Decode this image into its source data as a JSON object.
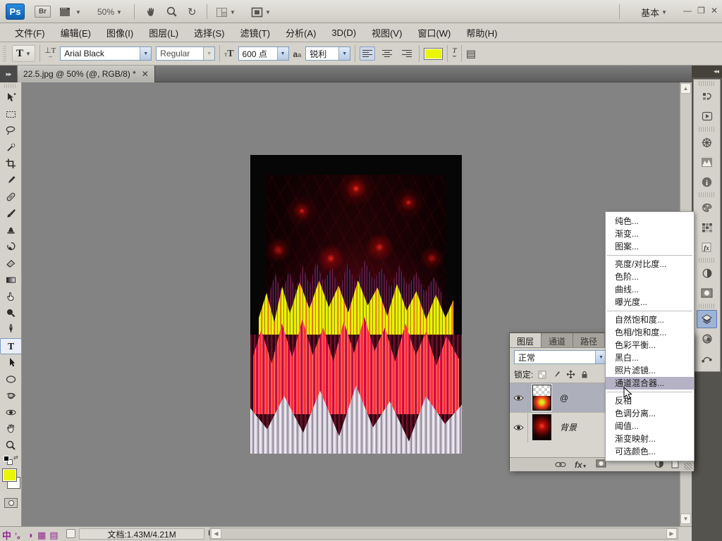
{
  "window": {
    "workspace": "基本"
  },
  "app_bar": {
    "ps_logo": "Ps",
    "bridge": "Br",
    "zoom_level": "50%"
  },
  "menu_bar": {
    "items": [
      "文件(F)",
      "编辑(E)",
      "图像(I)",
      "图层(L)",
      "选择(S)",
      "滤镜(T)",
      "分析(A)",
      "3D(D)",
      "视图(V)",
      "窗口(W)",
      "帮助(H)"
    ]
  },
  "options_bar": {
    "font_family": "Arial Black",
    "font_style": "Regular",
    "font_size": "600 点",
    "anti_alias": "锐利"
  },
  "document": {
    "tab_title": "22.5.jpg @ 50% (@, RGB/8) *"
  },
  "layers_panel": {
    "tabs": [
      "图层",
      "通道",
      "路径"
    ],
    "blend_mode": "正常",
    "lock_label": "锁定:",
    "fx_label": "fx",
    "layers": [
      {
        "name": "@"
      },
      {
        "name": "背景"
      }
    ]
  },
  "adjustments_menu": {
    "highlighted_item": "通道混合器...",
    "items": [
      {
        "label": "纯色..."
      },
      {
        "label": "渐变..."
      },
      {
        "label": "图案..."
      },
      {
        "label": "亮度/对比度..."
      },
      {
        "label": "色阶..."
      },
      {
        "label": "曲线..."
      },
      {
        "label": "曝光度..."
      },
      {
        "label": "自然饱和度..."
      },
      {
        "label": "色相/饱和度..."
      },
      {
        "label": "色彩平衡..."
      },
      {
        "label": "黑白..."
      },
      {
        "label": "照片滤镜..."
      },
      {
        "label": "通道混合器..."
      },
      {
        "label": "反相"
      },
      {
        "label": "色调分离..."
      },
      {
        "label": "阈值..."
      },
      {
        "label": "渐变映射..."
      },
      {
        "label": "可选颜色..."
      }
    ]
  },
  "status_bar": {
    "doc_info": "文档:1.43M/4.21M"
  },
  "colors": {
    "foreground": "#eaf607",
    "menu_highlight": "#b5b2c6",
    "ps_logo_bg": "#1474c4"
  }
}
